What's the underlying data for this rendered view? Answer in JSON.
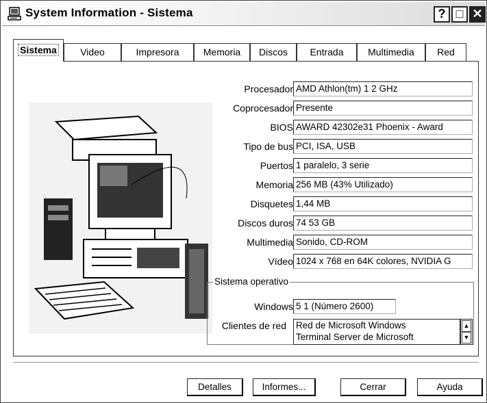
{
  "window": {
    "title": "System Information - Sistema"
  },
  "tabs": [
    {
      "label": "Sistema",
      "active": true
    },
    {
      "label": "Video",
      "active": false
    },
    {
      "label": "Impresora",
      "active": false
    },
    {
      "label": "Memoria",
      "active": false
    },
    {
      "label": "Discos",
      "active": false
    },
    {
      "label": "Entrada",
      "active": false
    },
    {
      "label": "Multimedia",
      "active": false
    },
    {
      "label": "Red",
      "active": false
    }
  ],
  "fields": [
    {
      "label": "Procesador",
      "value": "AMD Athlon(tm) 1 2 GHz"
    },
    {
      "label": "Coprocesador",
      "value": "Presente"
    },
    {
      "label": "BIOS",
      "value": "AWARD 42302e31 Phoenix - Award"
    },
    {
      "label": "Tipo de bus",
      "value": "PCI, ISA, USB"
    },
    {
      "label": "Puertos",
      "value": "1 paralelo, 3 serie"
    },
    {
      "label": "Memoria",
      "value": "256 MB (43% Utilizado)"
    },
    {
      "label": "Disquetes",
      "value": "1,44 MB"
    },
    {
      "label": "Discos duros",
      "value": "74 53 GB"
    },
    {
      "label": "Multimedia",
      "value": "Sonido, CD-ROM"
    },
    {
      "label": "Vídeo",
      "value": "1024 x 768 en 64K colores, NVIDIA G"
    }
  ],
  "os_group": {
    "title": "Sistema operativo",
    "windows_label": "Windows",
    "windows_value": "5 1 (Número 2600)",
    "clients_label": "Clientes de red",
    "clients": [
      "Red de Microsoft Windows",
      "Terminal Server de Microsoft"
    ]
  },
  "buttons": {
    "details": "Detalles",
    "reports": "Informes...",
    "close": "Cerrar",
    "help": "Ayuda"
  },
  "icons": {
    "title": "system-info-icon",
    "minimize": "help-icon",
    "maximize": "maximize-icon",
    "close": "close-icon"
  }
}
